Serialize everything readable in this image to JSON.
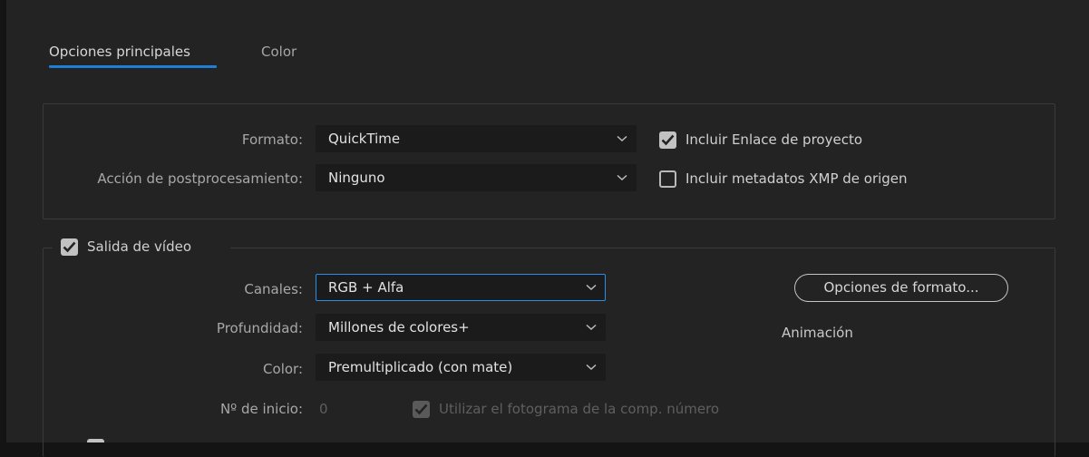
{
  "tabs": [
    {
      "label": "Opciones principales",
      "active": true
    },
    {
      "label": "Color",
      "active": false
    }
  ],
  "format_section": {
    "format_label": "Formato:",
    "format_value": "QuickTime",
    "post_label": "Acción de postprocesamiento:",
    "post_value": "Ninguno",
    "include_project_link": {
      "label": "Incluir Enlace de proyecto",
      "checked": true
    },
    "include_xmp": {
      "label": "Incluir metadatos XMP de origen",
      "checked": false
    }
  },
  "video_section": {
    "toggle_label": "Salida de vídeo",
    "toggle_checked": true,
    "channels_label": "Canales:",
    "channels_value": "RGB + Alfa",
    "depth_label": "Profundidad:",
    "depth_value": "Millones de colores+",
    "color_label": "Color:",
    "color_value": "Premultiplicado (con mate)",
    "start_label": "Nº de inicio:",
    "start_value": "0",
    "use_comp_frame": {
      "label": "Utilizar el fotograma de la comp. número",
      "checked": true,
      "disabled": true
    },
    "format_options_button": "Opciones de formato...",
    "codec_text": "Animación"
  },
  "colors": {
    "accent": "#1e7fd6",
    "focus": "#2d8ceb",
    "panel": "#232323",
    "field": "#1b1b1b"
  }
}
